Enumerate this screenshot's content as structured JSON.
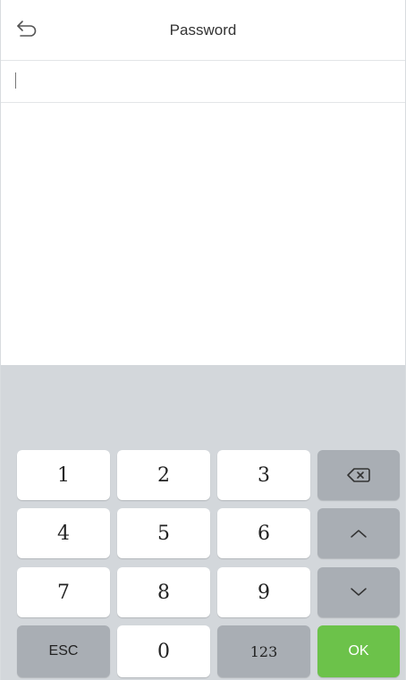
{
  "header": {
    "title": "Password",
    "back_icon": "back-arrow-icon"
  },
  "password_field": {
    "value": "",
    "placeholder": ""
  },
  "keypad": {
    "digits": [
      "1",
      "2",
      "3",
      "4",
      "5",
      "6",
      "7",
      "8",
      "9",
      "0"
    ],
    "esc_label": "ESC",
    "mode_label": "123",
    "ok_label": "OK",
    "backspace_icon": "backspace-icon",
    "up_icon": "chevron-up-icon",
    "down_icon": "chevron-down-icon"
  },
  "colors": {
    "ok_button": "#6cc24a",
    "keyboard_background": "#d3d7db",
    "function_key": "#a9aeb4"
  }
}
